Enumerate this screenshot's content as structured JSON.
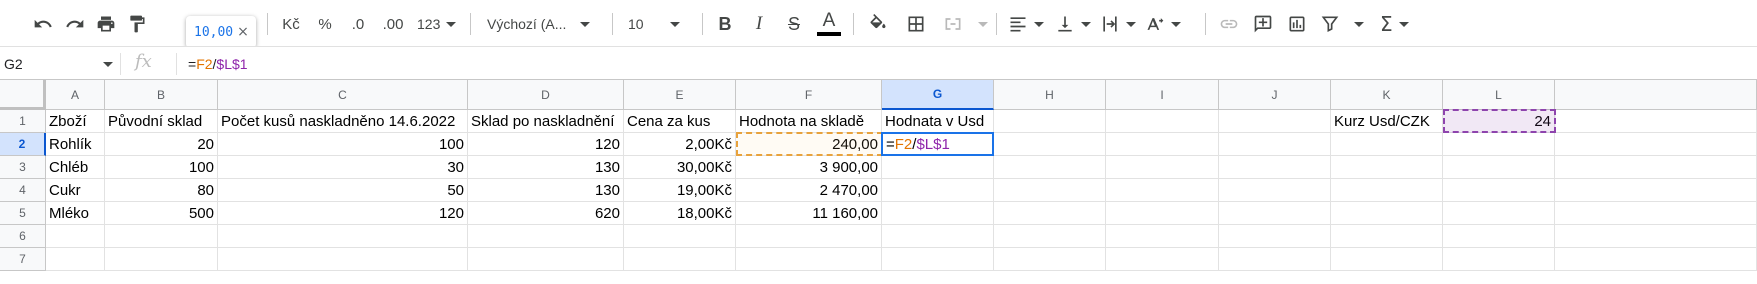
{
  "toolbar": {
    "undo_icon": "undo-icon",
    "redo_icon": "redo-icon",
    "print_icon": "print-icon",
    "paint_format_icon": "paint-format-icon",
    "zoom_tip_value": "10,00",
    "zoom_tip_close": "×",
    "currency_label": "Kč",
    "percent_label": "%",
    "decrease_decimal_label": ".0",
    "increase_decimal_label": ".00",
    "more_formats_label": "123",
    "font_family": "Výchozí (A...",
    "font_size": "10",
    "bold_label": "B",
    "italic_label": "I",
    "strike_label": "S",
    "text_color_label": "A",
    "text_color": "#000000"
  },
  "formula_bar": {
    "name_box": "G2",
    "fx_label": "fx",
    "formula_eq": "=",
    "formula_ref1": "F2",
    "formula_div": "/",
    "formula_ref2": "$L$1"
  },
  "columns": [
    "A",
    "B",
    "C",
    "D",
    "E",
    "F",
    "G",
    "H",
    "I",
    "J",
    "K",
    "L"
  ],
  "selected_column": "G",
  "rows": [
    "1",
    "2",
    "3",
    "4",
    "5",
    "6",
    "7"
  ],
  "selected_row": "2",
  "cells": {
    "r1": {
      "A": "Zboží",
      "B": "Původní sklad",
      "C": "Počet kusů naskladněno 14.6.2022",
      "D": "Sklad po naskladnění",
      "E": "Cena za kus",
      "F": "Hodnota na skladě",
      "G": "Hodnata v Usd",
      "K": "Kurz Usd/CZK",
      "L": "24"
    },
    "r2": {
      "A": "Rohlík",
      "B": "20",
      "C": "100",
      "D": "120",
      "E": "2,00Kč",
      "F": "240,00"
    },
    "r3": {
      "A": "Chléb",
      "B": "100",
      "C": "30",
      "D": "130",
      "E": "30,00Kč",
      "F": "3 900,00"
    },
    "r4": {
      "A": "Cukr",
      "B": "80",
      "C": "50",
      "D": "130",
      "E": "19,00Kč",
      "F": "2 470,00"
    },
    "r5": {
      "A": "Mléko",
      "B": "500",
      "C": "120",
      "D": "620",
      "E": "18,00Kč",
      "F": "11 160,00"
    }
  },
  "colors": {
    "ref_f2": "#e37400",
    "ref_l1": "#8e24aa",
    "active": "#1a73e8"
  }
}
